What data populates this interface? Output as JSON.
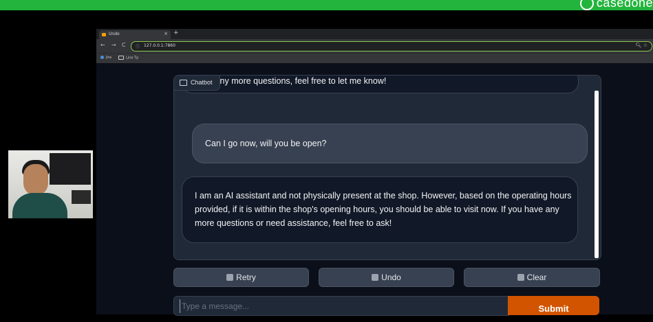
{
  "brand": {
    "name": "casedone"
  },
  "browser": {
    "tab_title": "Undo",
    "tab_close": "×",
    "new_tab": "+",
    "url": "127.0.0.1:7860",
    "nav": {
      "back": "←",
      "forward": "→",
      "reload": "C"
    },
    "bookmarks": [
      "Jira",
      "Line Tp"
    ]
  },
  "chat": {
    "label": "Chatbot",
    "messages": [
      {
        "role": "assistant",
        "text": "have any more questions, feel free to let me know!"
      },
      {
        "role": "user",
        "text": "Can I go now, will you be open?"
      },
      {
        "role": "assistant",
        "text": "I am an AI assistant and not physically present at the shop. However, based on the operating hours provided, if it is within the shop's opening hours, you should be able to visit now. If you have any more questions or need assistance, feel free to ask!"
      }
    ]
  },
  "actions": {
    "retry": "Retry",
    "undo": "Undo",
    "clear": "Clear"
  },
  "input": {
    "placeholder": "Type a message...",
    "submit": "Submit"
  },
  "colors": {
    "top_bar": "#22b43c",
    "submit": "#d35400",
    "url_focus": "#8ccb4e"
  }
}
